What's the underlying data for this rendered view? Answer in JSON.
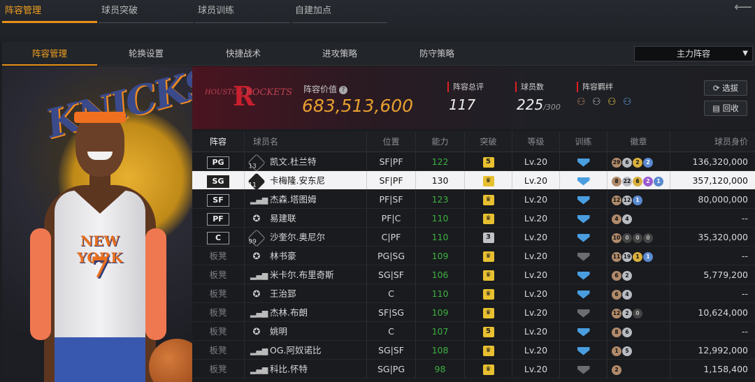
{
  "top_tabs": [
    {
      "label": "阵容管理"
    },
    {
      "label": "球员突破"
    },
    {
      "label": "球员训练"
    },
    {
      "label": "自建加点"
    }
  ],
  "sub_tabs": [
    {
      "label": "阵容管理"
    },
    {
      "label": "轮换设置"
    },
    {
      "label": "快捷战术"
    },
    {
      "label": "进攻策略"
    },
    {
      "label": "防守策略"
    }
  ],
  "lineup_select": {
    "value": "主力阵容"
  },
  "player_art": {
    "jersey_text": "NEW YORK",
    "jersey_number": "7",
    "bg_text": "KNICKS"
  },
  "team": {
    "logo_left": "HOUSTON",
    "logo_right": "ROCKETS",
    "logo_mark": "R",
    "value_label": "阵容价值",
    "value": "683,513,600"
  },
  "stats": {
    "rating_label": "阵容总评",
    "rating": "117",
    "count_label": "球员数",
    "count": "225",
    "count_max": "/300",
    "bond_label": "阵容羁绊"
  },
  "buttons": {
    "select": "选拔",
    "recycle": "回收"
  },
  "columns": [
    "阵容",
    "球员名",
    "位置",
    "能力",
    "突破",
    "等级",
    "训练",
    "徽章",
    "球员身价"
  ],
  "rows": [
    {
      "slot": "PG",
      "icon": "13",
      "name": "凯文.杜兰特",
      "pos": "SF|PF",
      "ability": "122",
      "brk": "5",
      "brk_type": "num",
      "lv": "Lv.20",
      "train": "blue",
      "badges": [
        [
          "29",
          "bronze"
        ],
        [
          "6",
          "silver"
        ],
        [
          "2",
          "gold"
        ],
        [
          "2",
          "blue"
        ]
      ],
      "price": "136,320,000"
    },
    {
      "slot": "SG",
      "icon": "11",
      "name": "卡梅隆.安东尼",
      "pos": "SF|PF",
      "ability": "130",
      "brk": "♛",
      "brk_type": "crown",
      "lv": "Lv.20",
      "train": "blue",
      "badges": [
        [
          "8",
          "bronze"
        ],
        [
          "22",
          "silver"
        ],
        [
          "6",
          "gold"
        ],
        [
          "2",
          "purple"
        ],
        [
          "1",
          "blue"
        ]
      ],
      "price": "357,120,000"
    },
    {
      "slot": "SF",
      "icon": "bar",
      "name": "杰森.塔图姆",
      "pos": "PF|SF",
      "ability": "123",
      "brk": "♛",
      "brk_type": "crown",
      "lv": "Lv.20",
      "train": "blue",
      "badges": [
        [
          "12",
          "bronze"
        ],
        [
          "12",
          "silver"
        ],
        [
          "1",
          "blue"
        ]
      ],
      "price": "80,000,000"
    },
    {
      "slot": "PF",
      "icon": "star",
      "name": "易建联",
      "pos": "PF|C",
      "ability": "110",
      "brk": "♛",
      "brk_type": "crown",
      "lv": "Lv.20",
      "train": "blue",
      "badges": [
        [
          "4",
          "bronze"
        ],
        [
          "4",
          "silver"
        ]
      ],
      "price": "--"
    },
    {
      "slot": "C",
      "icon": "99",
      "name": "沙奎尔.奥尼尔",
      "pos": "C|PF",
      "ability": "110",
      "brk": "3",
      "brk_type": "grey",
      "lv": "Lv.20",
      "train": "blue",
      "badges": [
        [
          "10",
          "bronze"
        ],
        [
          "0",
          "dark"
        ],
        [
          "0",
          "dark"
        ],
        [
          "0",
          "dark"
        ]
      ],
      "price": "35,320,000"
    },
    {
      "slot": "板凳",
      "icon": "star",
      "name": "林书豪",
      "pos": "PG|SG",
      "ability": "109",
      "brk": "♛",
      "brk_type": "crown",
      "lv": "Lv.20",
      "train": "grey",
      "badges": [
        [
          "11",
          "bronze"
        ],
        [
          "19",
          "silver"
        ],
        [
          "1",
          "gold"
        ],
        [
          "1",
          "blue"
        ]
      ],
      "price": "--"
    },
    {
      "slot": "板凳",
      "icon": "bar",
      "name": "米卡尔.布里奇斯",
      "pos": "SG|SF",
      "ability": "106",
      "brk": "♛",
      "brk_type": "crown",
      "lv": "Lv.20",
      "train": "blue",
      "badges": [
        [
          "6",
          "bronze"
        ],
        [
          "2",
          "silver"
        ]
      ],
      "price": "5,779,200"
    },
    {
      "slot": "板凳",
      "icon": "star",
      "name": "王治郅",
      "pos": "C",
      "ability": "110",
      "brk": "♛",
      "brk_type": "crown",
      "lv": "Lv.20",
      "train": "blue",
      "badges": [
        [
          "6",
          "bronze"
        ],
        [
          "4",
          "silver"
        ]
      ],
      "price": "--"
    },
    {
      "slot": "板凳",
      "icon": "bar",
      "name": "杰林.布朗",
      "pos": "SF|SG",
      "ability": "109",
      "brk": "♛",
      "brk_type": "crown",
      "lv": "Lv.20",
      "train": "grey",
      "badges": [
        [
          "12",
          "bronze"
        ],
        [
          "2",
          "silver"
        ],
        [
          "0",
          "dark"
        ]
      ],
      "price": "10,624,000"
    },
    {
      "slot": "板凳",
      "icon": "star",
      "name": "姚明",
      "pos": "C",
      "ability": "107",
      "brk": "5",
      "brk_type": "num",
      "lv": "Lv.20",
      "train": "blue",
      "badges": [
        [
          "8",
          "bronze"
        ],
        [
          "6",
          "silver"
        ]
      ],
      "price": "--"
    },
    {
      "slot": "板凳",
      "icon": "bar",
      "name": "OG.阿奴诺比",
      "pos": "SG|SF",
      "ability": "108",
      "brk": "♛",
      "brk_type": "crown",
      "lv": "Lv.20",
      "train": "blue",
      "badges": [
        [
          "1",
          "bronze"
        ],
        [
          "5",
          "silver"
        ]
      ],
      "price": "12,992,000"
    },
    {
      "slot": "板凳",
      "icon": "bar",
      "name": "科比.怀特",
      "pos": "SG|PG",
      "ability": "98",
      "brk": "♛",
      "brk_type": "crown",
      "lv": "Lv.20",
      "train": "grey",
      "badges": [
        [
          "2",
          "bronze"
        ]
      ],
      "price": "1,158,400"
    }
  ]
}
